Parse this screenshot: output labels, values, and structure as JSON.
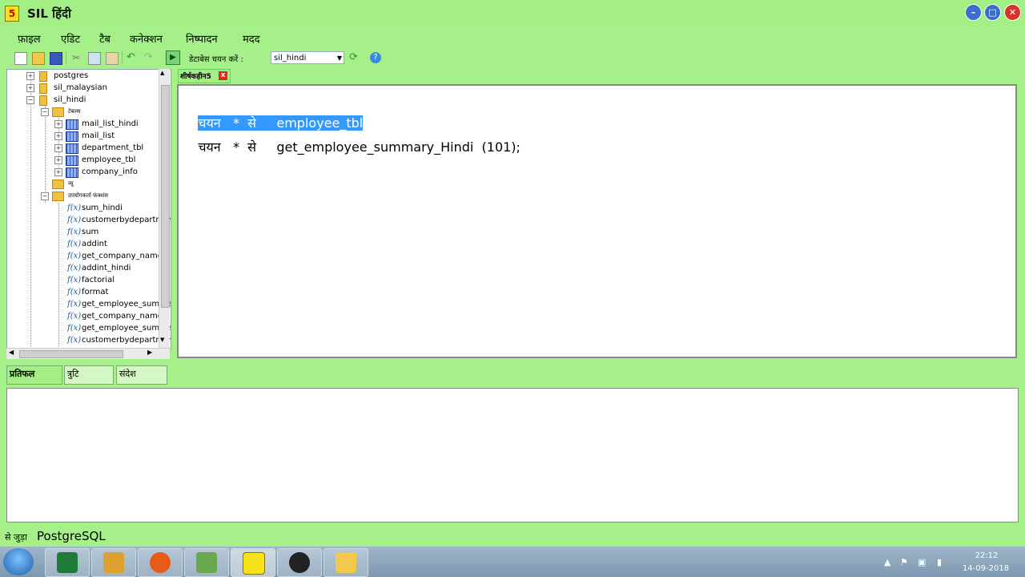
{
  "window": {
    "title": "SIL हिंदी",
    "icon_glyph": "5"
  },
  "menu": [
    "फ़ाइल",
    "एडिट",
    "टैब",
    "कनेक्शन",
    "निष्पादन",
    "मदद"
  ],
  "toolbar": {
    "db_label": "डेटाबेस चयन करें :",
    "db_selected": "sil_hindi",
    "icons": [
      "new-file-icon",
      "open-folder-icon",
      "save-icon",
      "cut-icon",
      "copy-icon",
      "paste-icon",
      "undo-icon",
      "redo-icon",
      "execute-icon",
      "refresh-icon",
      "help-icon"
    ]
  },
  "tree": {
    "databases": [
      "postgres",
      "sil_malaysian",
      "sil_hindi"
    ],
    "tables_folder": "टेबल्स",
    "tables": [
      "mail_list_hindi",
      "mail_list",
      "department_tbl",
      "employee_tbl",
      "company_info"
    ],
    "views_folder": "व्यू",
    "functions_folder": "उपयोगकर्ता फंक्शंस",
    "functions": [
      "sum_hindi",
      "customerbydepartmer",
      "sum",
      "addint",
      "get_company_name",
      "addint_hindi",
      "factorial",
      "format",
      "get_employee_summa",
      "get_company_name_",
      "get_employee_summa",
      "customerbydepartmer"
    ]
  },
  "editor": {
    "tab_label": "शीर्षकहीन5",
    "lines": [
      {
        "kw": "चयन",
        "star": "*",
        "from": "से",
        "rest": "employee_tbl"
      },
      {
        "kw": "चयन",
        "star": "*",
        "from": "से",
        "rest": "get_employee_summary_Hindi  (101);"
      }
    ]
  },
  "bottom_tabs": [
    "प्रतिफल",
    "त्रुटि",
    "संदेश"
  ],
  "status": {
    "prefix": "से जुड़ा",
    "text": "PostgreSQL"
  },
  "taskbar": {
    "apps": [
      "excel-icon",
      "outlook-icon",
      "firefox-icon",
      "chart-editor-icon",
      "sil-hindi-icon",
      "obs-icon",
      "file-explorer-icon"
    ],
    "time": "22:12",
    "date": "14-09-2018"
  },
  "colors": {
    "app_bg": "#a6f08a",
    "selection": "#3399ff",
    "close": "#d8332a"
  }
}
